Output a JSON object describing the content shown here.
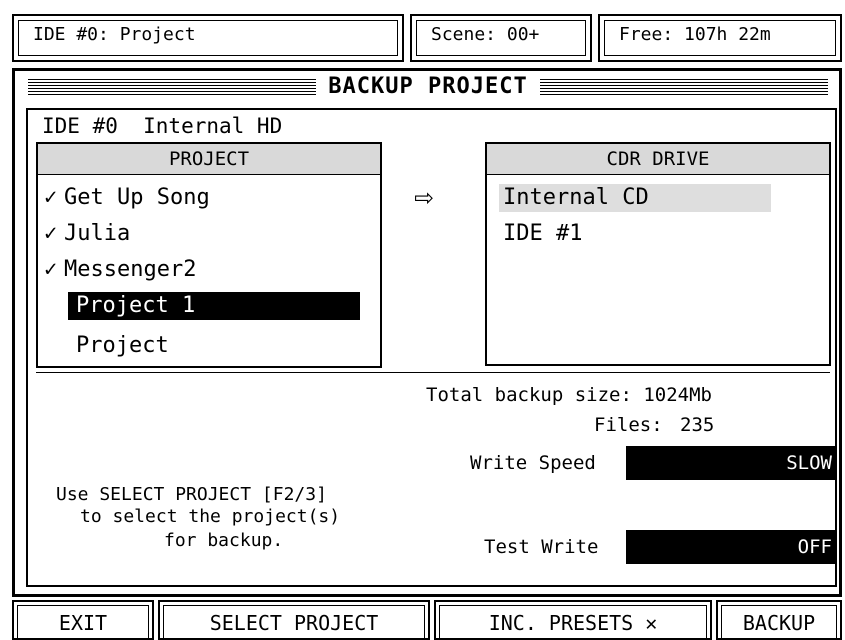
{
  "status_bar": {
    "device_project": "IDE #0: Project",
    "scene": "Scene: 00+",
    "free_time": "Free: 107h 22m"
  },
  "dialog": {
    "title": "BACKUP PROJECT",
    "source_drive": "IDE #0  Internal HD",
    "project_header": "PROJECT",
    "projects": [
      {
        "name": "Get Up Song",
        "checked": true,
        "selected": false
      },
      {
        "name": "Julia",
        "checked": true,
        "selected": false
      },
      {
        "name": "Messenger2",
        "checked": true,
        "selected": false
      },
      {
        "name": "Project 1",
        "checked": false,
        "selected": true
      },
      {
        "name": "Project",
        "checked": false,
        "selected": false
      }
    ],
    "check_glyph": "✓",
    "arrow_icon": "⇨",
    "cdr_header": "CDR DRIVE",
    "cdr_drives": [
      {
        "name": "Internal CD",
        "highlighted": true
      },
      {
        "name": "IDE #1",
        "highlighted": false
      }
    ],
    "total_backup_size": "Total backup size: 1024Mb",
    "files_label": "Files:",
    "files_value": "235",
    "write_speed_label": "Write Speed",
    "write_speed_value": "SLOW",
    "test_write_label": "Test Write",
    "test_write_value": "OFF",
    "help_line1": "Use SELECT PROJECT [F2/3]",
    "help_line2": "to select the project(s)",
    "help_line3": "for backup."
  },
  "softkeys": {
    "exit": "EXIT",
    "select_project": "SELECT PROJECT",
    "inc_presets": "INC. PRESETS",
    "inc_presets_state_icon": "✕",
    "backup": "BACKUP"
  },
  "colors": {
    "background": "#ffffff",
    "foreground": "#000000",
    "header_gray": "#d9d9d9",
    "highlight_gray": "#dedede"
  }
}
